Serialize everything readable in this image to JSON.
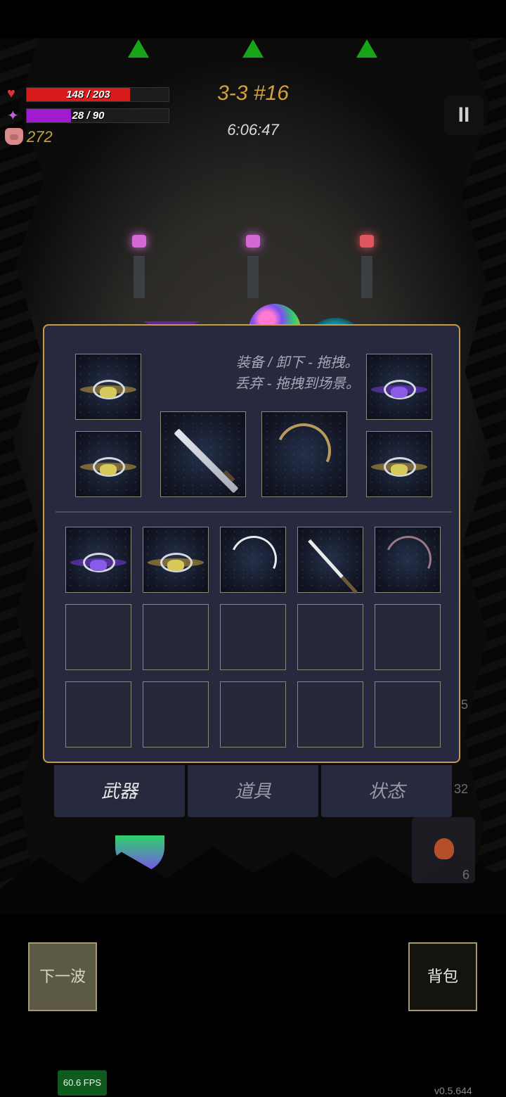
{
  "hud": {
    "hp_text": "148 / 203",
    "hp_fraction": 0.729,
    "mp_text": "28 / 90",
    "mp_fraction": 0.311,
    "gold": "272",
    "level": "3-3 #16",
    "timer": "6:06:47",
    "pause_label": "II"
  },
  "colors": {
    "hp": "#d81c1c",
    "mp": "#a01ad0",
    "panel_border": "#c79a45",
    "panel_bg": "#272a3e",
    "wave_arrow": "#18a418"
  },
  "inventory": {
    "hint_line1": "装备 / 卸下 - 拖拽。",
    "hint_line2": "丢弃 - 拖拽到场景。",
    "equipped": [
      {
        "icon": "ring-gold-gem",
        "slot": "left-top"
      },
      {
        "icon": "ring-gold-gem",
        "slot": "left-bottom"
      },
      {
        "icon": "silver-sword",
        "slot": "weapon-1"
      },
      {
        "icon": "golden-bow",
        "slot": "weapon-2"
      },
      {
        "icon": "ring-purple-gem",
        "slot": "right-top"
      },
      {
        "icon": "ring-gold-gem",
        "slot": "right-bottom"
      }
    ],
    "backpack": [
      {
        "icon": "ring-purple-gem"
      },
      {
        "icon": "ring-gold-gem"
      },
      {
        "icon": "white-bow"
      },
      {
        "icon": "katana"
      },
      {
        "icon": "dark-bow"
      },
      {
        "icon": ""
      },
      {
        "icon": ""
      },
      {
        "icon": ""
      },
      {
        "icon": ""
      },
      {
        "icon": ""
      },
      {
        "icon": ""
      },
      {
        "icon": ""
      },
      {
        "icon": ""
      },
      {
        "icon": ""
      },
      {
        "icon": ""
      }
    ]
  },
  "tabs": [
    {
      "label": "武器",
      "active": true
    },
    {
      "label": "道具",
      "active": false
    },
    {
      "label": "状态",
      "active": false
    }
  ],
  "side_numbers": [
    "5",
    "32",
    "6"
  ],
  "buttons": {
    "next_wave": "下一波",
    "backpack": "背包"
  },
  "fps": "60.6 FPS",
  "version": "v0.5.644"
}
